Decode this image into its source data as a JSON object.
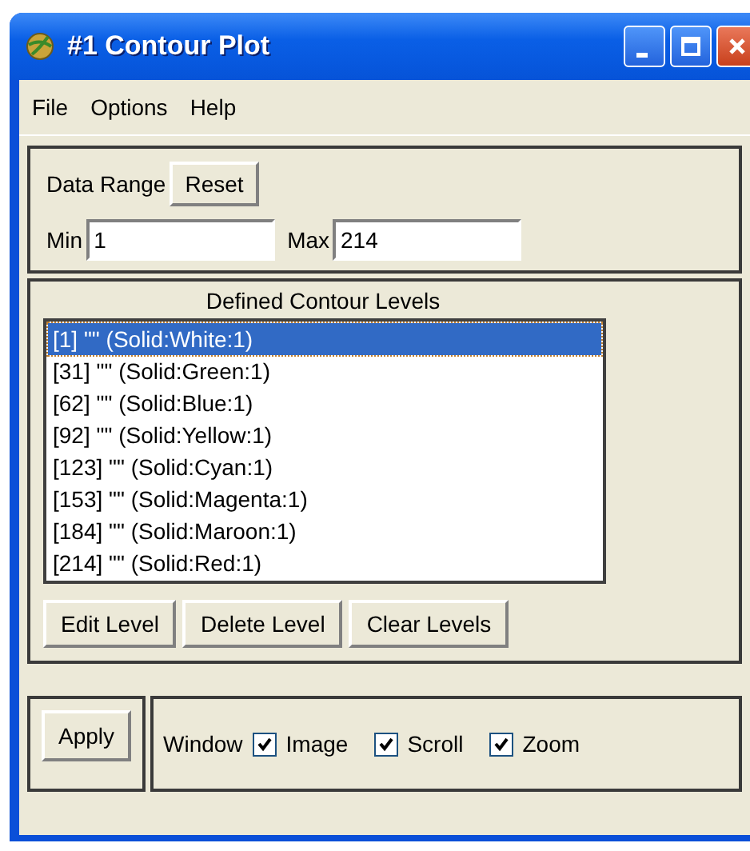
{
  "window": {
    "title": "#1 Contour Plot"
  },
  "menu": [
    "File",
    "Options",
    "Help"
  ],
  "data_range": {
    "label": "Data Range",
    "reset_button": "Reset",
    "min_label": "Min",
    "min_value": "1",
    "max_label": "Max",
    "max_value": "214"
  },
  "levels": {
    "heading": "Defined Contour Levels",
    "items": [
      {
        "text": "[1] \"\" (Solid:White:1)",
        "selected": true
      },
      {
        "text": "[31] \"\" (Solid:Green:1)",
        "selected": false
      },
      {
        "text": "[62] \"\" (Solid:Blue:1)",
        "selected": false
      },
      {
        "text": "[92] \"\" (Solid:Yellow:1)",
        "selected": false
      },
      {
        "text": "[123] \"\" (Solid:Cyan:1)",
        "selected": false
      },
      {
        "text": "[153] \"\" (Solid:Magenta:1)",
        "selected": false
      },
      {
        "text": "[184] \"\" (Solid:Maroon:1)",
        "selected": false
      },
      {
        "text": "[214] \"\" (Solid:Red:1)",
        "selected": false
      }
    ],
    "buttons": [
      "Edit Level",
      "Delete Level",
      "Clear Levels"
    ]
  },
  "apply_button": "Apply",
  "window_label": "Window",
  "options": [
    {
      "label": "Image",
      "checked": true
    },
    {
      "label": "Scroll",
      "checked": true
    },
    {
      "label": "Zoom",
      "checked": true
    }
  ]
}
